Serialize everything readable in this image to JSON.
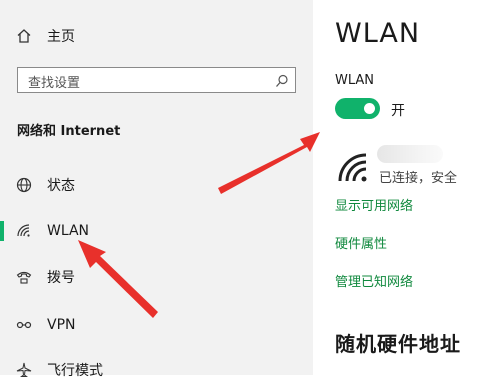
{
  "sidebar": {
    "home_label": "主页",
    "search_placeholder": "查找设置",
    "section_title": "网络和 Internet",
    "items": [
      {
        "label": "状态",
        "icon": "globe-icon"
      },
      {
        "label": "WLAN",
        "icon": "wifi-icon",
        "selected": true
      },
      {
        "label": "拨号",
        "icon": "dialup-icon"
      },
      {
        "label": "VPN",
        "icon": "vpn-icon"
      },
      {
        "label": "飞行模式",
        "icon": "airplane-icon"
      }
    ]
  },
  "main": {
    "title": "WLAN",
    "wlan_label": "WLAN",
    "toggle_state": "开",
    "network_status": "已连接，安全",
    "links": [
      "显示可用网络",
      "硬件属性",
      "管理已知网络"
    ],
    "section_random": "随机硬件地址"
  },
  "colors": {
    "accent": "#10b26b",
    "link": "#10893e",
    "sidebar_bg": "#f2f2f2",
    "annotation_arrow": "#e8302b"
  }
}
